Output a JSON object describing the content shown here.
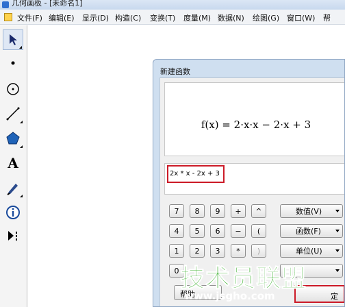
{
  "window": {
    "title": "几何画板 - [未命名1]"
  },
  "menubar": {
    "items": [
      "文件(F)",
      "编辑(E)",
      "显示(D)",
      "构造(C)",
      "变换(T)",
      "度量(M)",
      "数据(N)",
      "绘图(G)",
      "窗口(W)",
      "帮"
    ]
  },
  "toolbox": {
    "tools": [
      "arrow-tool-icon",
      "point-tool-icon",
      "compass-tool-icon",
      "line-tool-icon",
      "polygon-tool-icon",
      "text-tool-icon",
      "marker-tool-icon",
      "info-tool-icon",
      "custom-tool-icon"
    ],
    "text_tool_label": "A"
  },
  "dialog": {
    "title": "新建函数",
    "preview_formula": "f(x) = 2·x·x − 2·x + 3",
    "expression_input": "2x * x - 2x + 3",
    "keypad": {
      "row1": [
        "7",
        "8",
        "9",
        "+",
        "^"
      ],
      "row2": [
        "4",
        "5",
        "6",
        "−",
        "("
      ],
      "row3": [
        "1",
        "2",
        "3",
        "*",
        ")"
      ],
      "row4": [
        "0"
      ]
    },
    "dropdowns": [
      "数值(V)",
      "函数(F)",
      "单位(U)",
      ""
    ],
    "help_label": "帮助",
    "ok_label": "定"
  },
  "watermark": {
    "text": "技术员联盟",
    "url": "www.jsgho.com"
  },
  "colors": {
    "highlight_red": "#cc1a27",
    "watermark_green": "#44b337"
  }
}
